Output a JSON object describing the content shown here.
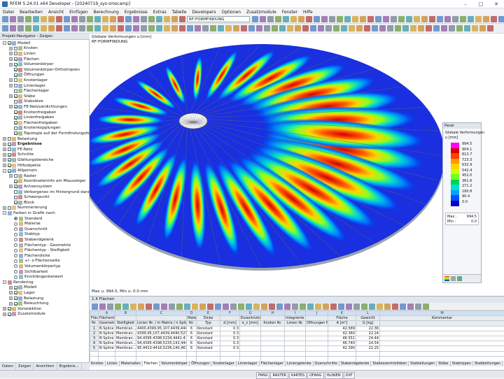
{
  "window": {
    "title": "RFEM 5.24.01 x64 Developer - [20240719_sys-smscamp]"
  },
  "menu": [
    "Datei",
    "Bearbeiten",
    "Ansicht",
    "Einfügen",
    "Berechnung",
    "Ergebnisse",
    "Extras",
    "Tabelle",
    "Developers",
    "Optionen",
    "Zusatzmodule",
    "Fenster",
    "Hilfe"
  ],
  "toolbar": {
    "loadcase": "RF-FORMFINDUNG"
  },
  "navigator": {
    "title": "Projekt-Navigator - Zeigen",
    "items": [
      {
        "label": "Modell",
        "lvl": 0,
        "exp": "-",
        "cb": true
      },
      {
        "label": "Knoten",
        "lvl": 1,
        "exp": "+",
        "cb": false
      },
      {
        "label": "Linien",
        "lvl": 1,
        "exp": "+",
        "cb": false
      },
      {
        "label": "Flächen",
        "lvl": 1,
        "exp": "+",
        "cb": true
      },
      {
        "label": "Volumenkörper",
        "lvl": 1,
        "exp": "+",
        "cb": true
      },
      {
        "label": "Volumenkörper-Orthotropien",
        "lvl": 1,
        "exp": "",
        "cb": true
      },
      {
        "label": "Öffnungen",
        "lvl": 1,
        "exp": "",
        "cb": true
      },
      {
        "label": "Knotenlager",
        "lvl": 1,
        "exp": "+",
        "cb": false
      },
      {
        "label": "Linienlager",
        "lvl": 1,
        "exp": "+",
        "cb": false
      },
      {
        "label": "Flächenlager",
        "lvl": 1,
        "exp": "",
        "cb": false
      },
      {
        "label": "Stäbe",
        "lvl": 1,
        "exp": "+",
        "cb": true
      },
      {
        "label": "Stabsätze",
        "lvl": 1,
        "exp": "",
        "cb": false
      },
      {
        "label": "FE-Netzverdichtungen",
        "lvl": 1,
        "exp": "+",
        "cb": true
      },
      {
        "label": "Knotenfreigaben",
        "lvl": 1,
        "exp": "",
        "cb": true
      },
      {
        "label": "Linienfreigaben",
        "lvl": 1,
        "exp": "",
        "cb": true
      },
      {
        "label": "Flächenfreigaben",
        "lvl": 1,
        "exp": "",
        "cb": true
      },
      {
        "label": "Knotenkopplungen",
        "lvl": 1,
        "exp": "",
        "cb": false
      },
      {
        "label": "Topologie auf der Formfindungsform",
        "lvl": 1,
        "exp": "",
        "cb": true
      },
      {
        "label": "Belastung",
        "lvl": 0,
        "exp": "+",
        "cb": false
      },
      {
        "label": "Ergebnisse",
        "lvl": 0,
        "exp": "+",
        "cb": true,
        "bold": true
      },
      {
        "label": "FE-Netz",
        "lvl": 0,
        "exp": "+",
        "cb": false
      },
      {
        "label": "Schnitte",
        "lvl": 0,
        "exp": "+",
        "cb": true
      },
      {
        "label": "Glättungsbereiche",
        "lvl": 0,
        "exp": "+",
        "cb": true
      },
      {
        "label": "Hilfsobjekte",
        "lvl": 0,
        "exp": "+",
        "cb": true
      },
      {
        "label": "Allgemein",
        "lvl": 0,
        "exp": "-",
        "cb": true
      },
      {
        "label": "Raster",
        "lvl": 1,
        "exp": "+",
        "cb": false
      },
      {
        "label": "Koordinateninfo am Mauszeiger",
        "lvl": 1,
        "exp": "",
        "cb": true
      },
      {
        "label": "Achsensystem",
        "lvl": 1,
        "exp": "+",
        "cb": true
      },
      {
        "label": "Verborgenes im Hintergrund darstellen",
        "lvl": 1,
        "exp": "",
        "cb": false
      },
      {
        "label": "Schwerpunkt",
        "lvl": 1,
        "exp": "",
        "cb": false
      },
      {
        "label": "Block",
        "lvl": 1,
        "exp": "",
        "cb": true
      },
      {
        "label": "Nummerierung",
        "lvl": 0,
        "exp": "+",
        "cb": false
      },
      {
        "label": "Farben in Grafik nach",
        "lvl": 0,
        "exp": "-",
        "cb": null
      },
      {
        "label": "Standard",
        "lvl": 1,
        "exp": "",
        "rb": true
      },
      {
        "label": "Material",
        "lvl": 1,
        "exp": "",
        "rb": false
      },
      {
        "label": "Querschnitt",
        "lvl": 1,
        "exp": "",
        "rb": false
      },
      {
        "label": "Stabtyp",
        "lvl": 1,
        "exp": "",
        "rb": false
      },
      {
        "label": "Stabendgelenk",
        "lvl": 1,
        "exp": "",
        "rb": false
      },
      {
        "label": "Flächentyp - Geometrie",
        "lvl": 1,
        "exp": "",
        "rb": false
      },
      {
        "label": "Flächentyp - Steifigkeit",
        "lvl": 1,
        "exp": "",
        "rb": false
      },
      {
        "label": "Flächendicke",
        "lvl": 1,
        "exp": "",
        "rb": false
      },
      {
        "label": "+/- z-Flächenseite",
        "lvl": 1,
        "exp": "",
        "rb": false
      },
      {
        "label": "Volumenkörpertyp",
        "lvl": 1,
        "exp": "",
        "rb": false
      },
      {
        "label": "Sichtbarkeit",
        "lvl": 1,
        "exp": "",
        "rb": false
      },
      {
        "label": "Knicklängenbeiwert",
        "lvl": 1,
        "exp": "",
        "rb": false
      },
      {
        "label": "Rendering",
        "lvl": 0,
        "exp": "-",
        "cb": null
      },
      {
        "label": "Modell",
        "lvl": 1,
        "exp": "+",
        "cb": true
      },
      {
        "label": "Lager",
        "lvl": 1,
        "exp": "+",
        "cb": true
      },
      {
        "label": "Belastung",
        "lvl": 1,
        "exp": "+",
        "cb": true
      },
      {
        "label": "Beleuchtung",
        "lvl": 1,
        "exp": "+",
        "cb": true
      },
      {
        "label": "Vorselektion",
        "lvl": 0,
        "exp": "+",
        "cb": true
      },
      {
        "label": "Zusatzmodule",
        "lvl": 0,
        "exp": "+",
        "cb": true
      }
    ],
    "tabs": [
      "Daten",
      "Zeigen",
      "Ansichten",
      "Ergebnis..."
    ]
  },
  "view": {
    "line1": "Globale Verformungen u [mm]",
    "line2": "RF-FORMFINDUNG",
    "maxmin": "Max u: 994.5, Min u: 0.0 mm"
  },
  "panel": {
    "title": "Panel",
    "heading": "Globale Verformungen",
    "unit": "u [mm]",
    "values": [
      "994.5",
      "904.1",
      "813.7",
      "723.3",
      "632.9",
      "542.4",
      "452.0",
      "361.6",
      "271.2",
      "180.8",
      "90.4",
      "0.0"
    ],
    "colors": [
      "#ff00ff",
      "#d80000",
      "#ff4000",
      "#ff9900",
      "#ffd400",
      "#d0ff00",
      "#70ff20",
      "#00d060",
      "#00e0d0",
      "#00a0ff",
      "#0050ff",
      "#0000c8"
    ],
    "max_label": "Max :",
    "max": "994.5",
    "min_label": "Min :",
    "min": "0.0"
  },
  "table": {
    "title": "1.4 Flächen",
    "letters": [
      "A",
      "B",
      "C",
      "D",
      "E",
      "F",
      "G",
      "H",
      "I",
      "J",
      "K",
      "L",
      "M"
    ],
    "head1": [
      "Fläche",
      "Flächentyp",
      "",
      "",
      "Material",
      "Dicke",
      "",
      "Exzentrizität",
      "",
      "Integrierte Objekte",
      "",
      "Fläche",
      "Gewicht",
      "Kommentar"
    ],
    "head2": [
      "Nr.",
      "Geometrie",
      "Steifigkeit",
      "Linien Nr. / m Matrix / n Spline",
      "Nr.",
      "Typ",
      "d [mm]",
      "e_z [mm]",
      "Knoten Nr.",
      "Linien Nr.",
      "Öffnungen Nr",
      "A [m²]",
      "G [kg]",
      ""
    ],
    "rows": [
      [
        "1",
        "B-Spline",
        "Membran...",
        "4400,4399,95,107,4439,4440,5",
        "6",
        "Konstant",
        "0.3",
        "",
        "",
        "",
        "",
        "42.589",
        "22.36",
        ""
      ],
      [
        "2",
        "B-Spline",
        "Membran...",
        "4399,95,107,4439,4440,5233,5",
        "6",
        "Konstant",
        "0.3",
        "",
        "",
        "",
        "",
        "42.360",
        "22.24",
        ""
      ],
      [
        "3",
        "B-Spline",
        "Membran...",
        "94,4395-4398,5234,4441-4",
        "6",
        "Konstant",
        "0.3",
        "",
        "",
        "",
        "",
        "46.551",
        "24.44",
        ""
      ],
      [
        "4",
        "B-Spline",
        "Membran...",
        "94,4395-4398,5235,142,4441-4",
        "6",
        "Konstant",
        "0.3",
        "",
        "",
        "",
        "",
        "46.740",
        "24.54",
        ""
      ],
      [
        "5",
        "B-Spline",
        "Membran...",
        "95,4413-4416,5236,140,4633-4",
        "6",
        "Konstant",
        "0.3",
        "",
        "",
        "",
        "",
        "42.390",
        "22.25",
        ""
      ]
    ],
    "tabs": [
      "Knoten",
      "Linien",
      "Materialien",
      "Flächen",
      "Volumenkörper",
      "Öffnungen",
      "Knotenlager",
      "Linienlager",
      "Flächenlager",
      "Liniengelenke",
      "Querschnitte",
      "Stabendgelenke",
      "Stabexzentrizitäten",
      "Stabteilungen",
      "Stäbe",
      "Stabrippen",
      "Stabbettungen",
      "Stabnichtlinearitäten",
      "Stabsätze"
    ],
    "active_tab": "Flächen"
  },
  "status": [
    "FANG",
    "RASTER",
    "KARTES",
    "OFANG",
    "HLINIEN",
    "DXF"
  ]
}
